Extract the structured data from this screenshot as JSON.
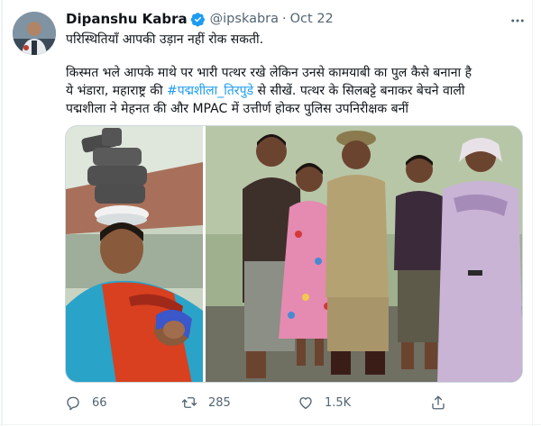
{
  "tweet": {
    "author_name": "Dipanshu Kabra",
    "handle": "@ipskabra",
    "separator": "·",
    "date": "Oct 22",
    "line1": "परिस्थितियाँ आपकी उड़ान नहीं रोक सकती.",
    "line2": "किस्मत भले आपके माथे पर भारी पत्थर रखे लेकिन उनसे कामयाबी का पुल कैसे बनाना है",
    "line3_before": "ये भंडारा, महाराष्ट्र की ",
    "hashtag": "#पद्मशीला_तिरपुडे",
    "line3_after": " से सीखें. पत्थर के सिलबट्टे बनाकर बेचने वाली",
    "line4": "पद्मशीला ने मेहनत की और MPAC में उत्तीर्ण होकर पुलिस उपनिरीक्षक बनीं"
  },
  "actions": {
    "reply_count": "66",
    "retweet_count": "285",
    "like_count": "1.5K"
  },
  "colors": {
    "text": "#0f1419",
    "secondary": "#536471",
    "accent": "#1d9bf0",
    "border": "#cfd9de"
  },
  "icons": {
    "verified": "verified-badge-icon",
    "more": "more-horizontal-icon",
    "reply": "reply-icon",
    "retweet": "retweet-icon",
    "like": "heart-icon",
    "share": "share-icon"
  }
}
